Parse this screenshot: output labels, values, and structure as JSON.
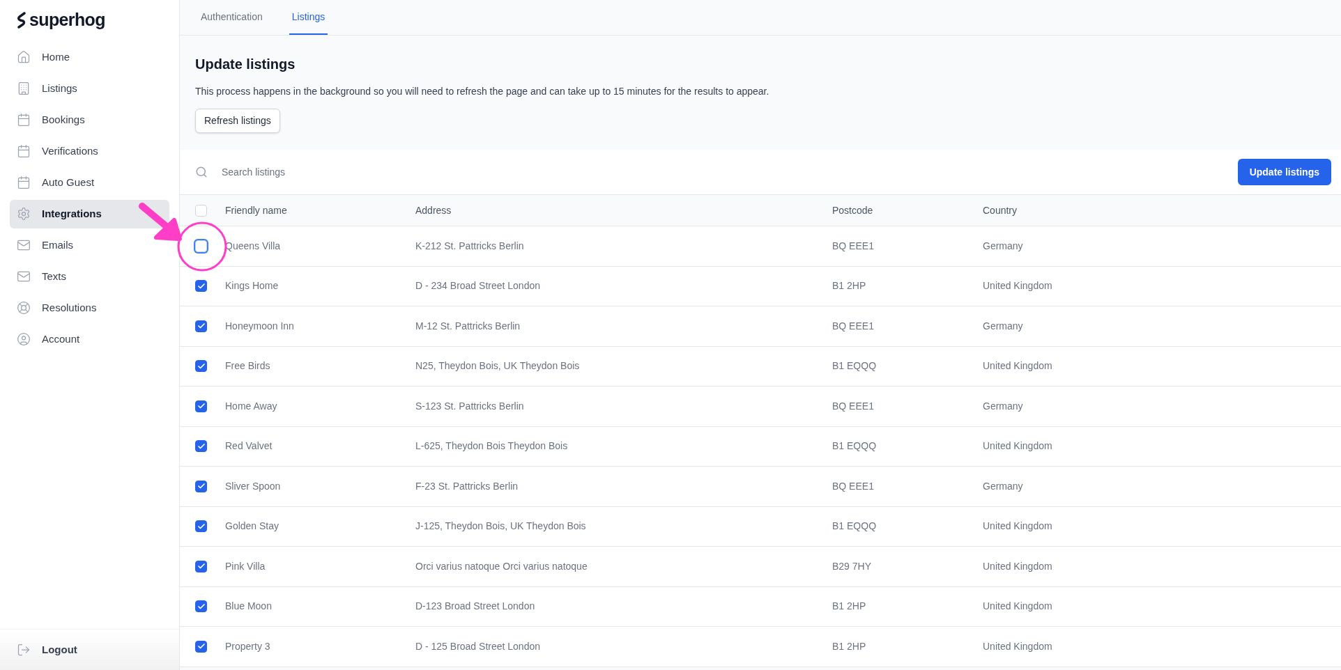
{
  "brand": "superhog",
  "sidebar": {
    "items": [
      {
        "label": "Home",
        "selected": false
      },
      {
        "label": "Listings",
        "selected": false
      },
      {
        "label": "Bookings",
        "selected": false
      },
      {
        "label": "Verifications",
        "selected": false
      },
      {
        "label": "Auto Guest",
        "selected": false
      },
      {
        "label": "Integrations",
        "selected": true
      },
      {
        "label": "Emails",
        "selected": false
      },
      {
        "label": "Texts",
        "selected": false
      },
      {
        "label": "Resolutions",
        "selected": false
      },
      {
        "label": "Account",
        "selected": false
      }
    ],
    "logout": "Logout"
  },
  "tabs": [
    {
      "label": "Authentication",
      "selected": false
    },
    {
      "label": "Listings",
      "selected": true
    }
  ],
  "section": {
    "title": "Update listings",
    "description": "This process happens in the background so you will need to refresh the page and can take up to 15 minutes for the results to appear.",
    "refresh_button": "Refresh listings"
  },
  "search": {
    "placeholder": "Search listings"
  },
  "update_button": "Update listings",
  "table": {
    "select_all_checked": false,
    "columns": [
      "Friendly name",
      "Address",
      "Postcode",
      "Country"
    ],
    "rows": [
      {
        "name": "Queens Villa",
        "address": "K-212 St. Pattricks Berlin",
        "postcode": "BQ EEE1",
        "country": "Germany",
        "checked": false,
        "focused": true
      },
      {
        "name": "Kings Home",
        "address": "D - 234 Broad Street London",
        "postcode": "B1 2HP",
        "country": "United Kingdom",
        "checked": true,
        "focused": false
      },
      {
        "name": "Honeymoon Inn",
        "address": "M-12 St. Pattricks Berlin",
        "postcode": "BQ EEE1",
        "country": "Germany",
        "checked": true,
        "focused": false
      },
      {
        "name": "Free Birds",
        "address": "N25, Theydon Bois, UK Theydon Bois",
        "postcode": "B1 EQQQ",
        "country": "United Kingdom",
        "checked": true,
        "focused": false
      },
      {
        "name": "Home Away",
        "address": "S-123 St. Pattricks Berlin",
        "postcode": "BQ EEE1",
        "country": "Germany",
        "checked": true,
        "focused": false
      },
      {
        "name": "Red Valvet",
        "address": "L-625, Theydon Bois Theydon Bois",
        "postcode": "B1 EQQQ",
        "country": "United Kingdom",
        "checked": true,
        "focused": false
      },
      {
        "name": "Sliver Spoon",
        "address": "F-23 St. Pattricks Berlin",
        "postcode": "BQ EEE1",
        "country": "Germany",
        "checked": true,
        "focused": false
      },
      {
        "name": "Golden Stay",
        "address": "J-125, Theydon Bois, UK Theydon Bois",
        "postcode": "B1 EQQQ",
        "country": "United Kingdom",
        "checked": true,
        "focused": false
      },
      {
        "name": "Pink Villa",
        "address": "Orci varius natoque Orci varius natoque",
        "postcode": "B29 7HY",
        "country": "United Kingdom",
        "checked": true,
        "focused": false
      },
      {
        "name": "Blue Moon",
        "address": "D-123 Broad Street London",
        "postcode": "B1 2HP",
        "country": "United Kingdom",
        "checked": true,
        "focused": false
      },
      {
        "name": "Property 3",
        "address": "D - 125 Broad Street London",
        "postcode": "B1 2HP",
        "country": "United Kingdom",
        "checked": true,
        "focused": false
      }
    ]
  }
}
